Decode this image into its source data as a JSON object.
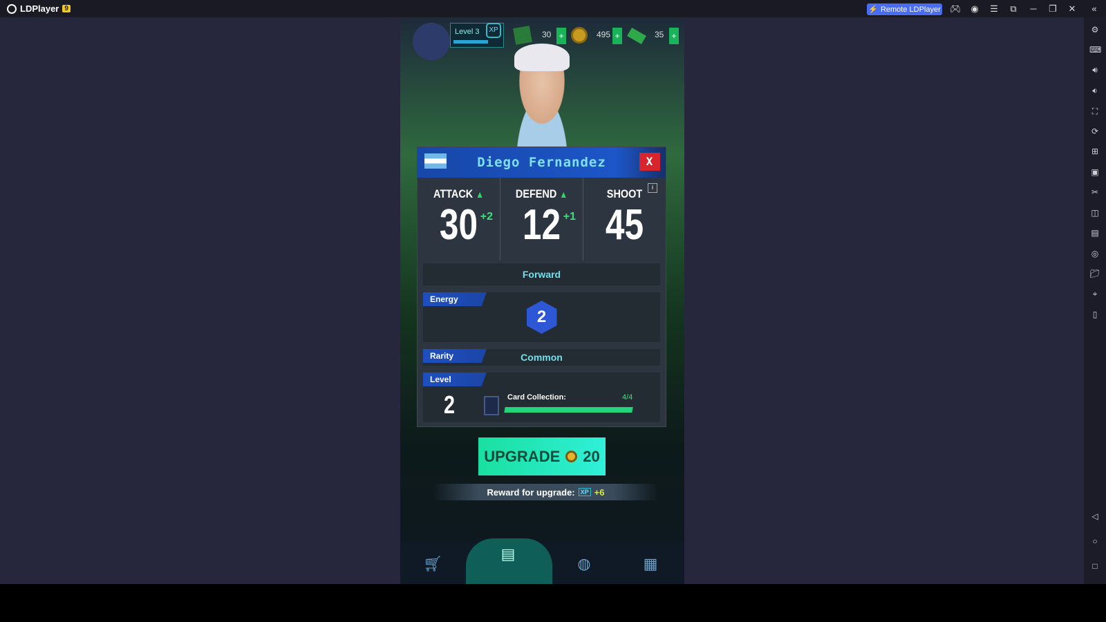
{
  "app": {
    "title": "LDPlayer",
    "version": "9",
    "remote_label": "Remote LDPlayer"
  },
  "hud": {
    "level": "Level 3",
    "xp": "XP",
    "cards": "30",
    "coins": "495",
    "cash": "35",
    "plus": "+"
  },
  "player": {
    "name": "Diego Fernandez",
    "close": "X",
    "stats": [
      {
        "label": "ATTACK",
        "value": "30",
        "bonus": "+2"
      },
      {
        "label": "DEFEND",
        "value": "12",
        "bonus": "+1"
      },
      {
        "label": "SHOOT",
        "value": "45",
        "bonus": ""
      }
    ],
    "info": "i",
    "position": "Forward",
    "energy_label": "Energy",
    "energy": "2",
    "rarity_label": "Rarity",
    "rarity": "Common",
    "level_label": "Level",
    "level": "2",
    "collection_label": "Card Collection:",
    "collection": "4/4",
    "collection_progress": 1.0
  },
  "upgrade": {
    "label": "UPGRADE",
    "cost": "20",
    "reward_label": "Reward for upgrade:",
    "reward_xp": "XP",
    "reward_value": "+6"
  },
  "colors": {
    "accent": "#1d56c8",
    "upgrade": "#19e0a0",
    "progress": "#23d47a",
    "close": "#d8242c"
  }
}
